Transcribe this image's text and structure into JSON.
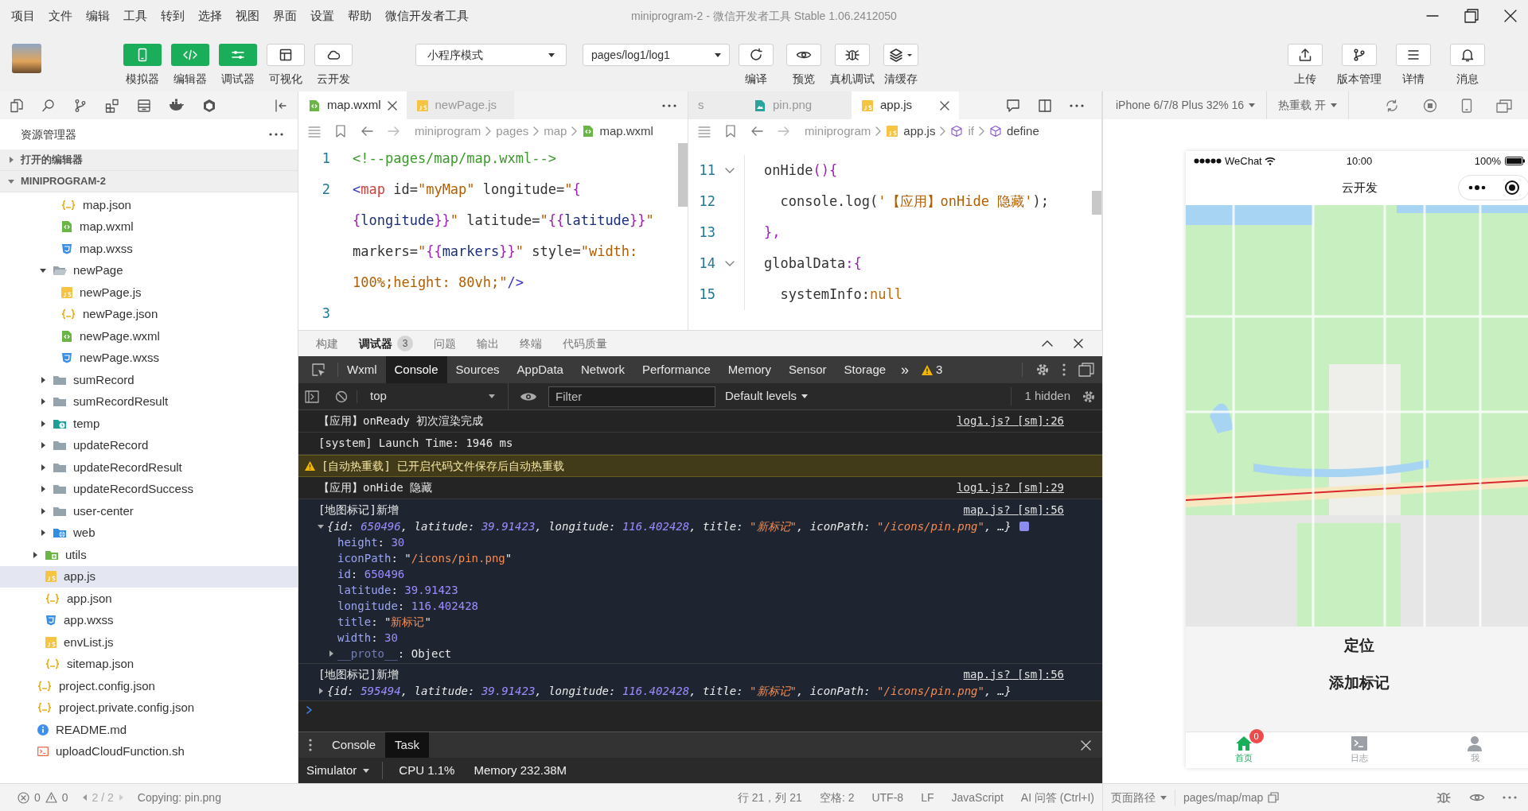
{
  "menu_bar": [
    "项目",
    "文件",
    "编辑",
    "工具",
    "转到",
    "选择",
    "视图",
    "界面",
    "设置",
    "帮助",
    "微信开发者工具"
  ],
  "window_title": "miniprogram-2 - 微信开发者工具 Stable 1.06.2412050",
  "toolbar": {
    "view_toggles": [
      {
        "label": "模拟器",
        "kind": "phone",
        "on": true
      },
      {
        "label": "编辑器",
        "kind": "code",
        "on": true
      },
      {
        "label": "调试器",
        "kind": "sliders",
        "on": true
      },
      {
        "label": "可视化",
        "kind": "layout",
        "on": false
      },
      {
        "label": "云开发",
        "kind": "cloud",
        "on": false
      }
    ],
    "mode_select": "小程序模式",
    "page_select": "pages/log1/log1",
    "actions": [
      {
        "label": "编译",
        "kind": "refresh"
      },
      {
        "label": "预览",
        "kind": "eye"
      },
      {
        "label": "真机调试",
        "kind": "bug"
      },
      {
        "label": "清缓存",
        "kind": "layers"
      }
    ],
    "right_actions": [
      {
        "label": "上传",
        "kind": "upload"
      },
      {
        "label": "版本管理",
        "kind": "branch"
      },
      {
        "label": "详情",
        "kind": "menu"
      },
      {
        "label": "消息",
        "kind": "bell"
      }
    ]
  },
  "explorer": {
    "title": "资源管理器",
    "sections": [
      {
        "label": "打开的编辑器",
        "expanded": false
      },
      {
        "label": "MINIPROGRAM-2",
        "expanded": true
      }
    ],
    "tree": [
      {
        "kind": "hidden",
        "children": [
          {
            "kind": "hidden",
            "children": [
              {
                "kind": "hidden",
                "children": [
                  {
                    "label": "map.json",
                    "kind": "json",
                    "selected": false
                  },
                  {
                    "label": "map.wxml",
                    "kind": "wxml",
                    "selected": false
                  },
                  {
                    "label": "map.wxss",
                    "kind": "wxss",
                    "selected": false
                  }
                ]
              },
              {
                "label": "newPage",
                "kind": "folder",
                "selected": false,
                "expanded": true,
                "children": [
                  {
                    "label": "newPage.js",
                    "kind": "js",
                    "selected": false
                  },
                  {
                    "label": "newPage.json",
                    "kind": "json",
                    "selected": false
                  },
                  {
                    "label": "newPage.wxml",
                    "kind": "wxml",
                    "selected": false
                  },
                  {
                    "label": "newPage.wxss",
                    "kind": "wxss",
                    "selected": false
                  }
                ]
              },
              {
                "label": "sumRecord",
                "kind": "folder",
                "selected": false,
                "expanded": false
              },
              {
                "label": "sumRecordResult",
                "kind": "folder",
                "selected": false,
                "expanded": false
              },
              {
                "label": "temp",
                "kind": "folder-temp",
                "selected": false,
                "expanded": false
              },
              {
                "label": "updateRecord",
                "kind": "folder",
                "selected": false,
                "expanded": false
              },
              {
                "label": "updateRecordResult",
                "kind": "folder",
                "selected": false,
                "expanded": false
              },
              {
                "label": "updateRecordSuccess",
                "kind": "folder",
                "selected": false,
                "expanded": false
              },
              {
                "label": "user-center",
                "kind": "folder",
                "selected": false,
                "expanded": false
              },
              {
                "label": "web",
                "kind": "folder-web",
                "selected": false,
                "expanded": false
              }
            ]
          },
          {
            "label": "utils",
            "kind": "folder-utils",
            "selected": false,
            "expanded": false
          },
          {
            "label": "app.js",
            "kind": "js",
            "selected": true
          },
          {
            "label": "app.json",
            "kind": "json",
            "selected": false
          },
          {
            "label": "app.wxss",
            "kind": "wxss",
            "selected": false
          },
          {
            "label": "envList.js",
            "kind": "js",
            "selected": false
          },
          {
            "label": "sitemap.json",
            "kind": "json",
            "selected": false
          }
        ]
      },
      {
        "label": "project.config.json",
        "kind": "json",
        "selected": false
      },
      {
        "label": "project.private.config.json",
        "kind": "json",
        "selected": false
      },
      {
        "label": "README.md",
        "kind": "info",
        "selected": false
      },
      {
        "label": "uploadCloudFunction.sh",
        "kind": "shell",
        "selected": false
      }
    ]
  },
  "editor_left": {
    "tabs": [
      {
        "label": "map.wxml",
        "kind": "wxml",
        "selected": true
      },
      {
        "label": "newPage.js",
        "kind": "js",
        "selected": false
      }
    ],
    "breadcrumb": [
      {
        "label": "miniprogram",
        "kind": "none"
      },
      {
        "label": "pages",
        "kind": "none"
      },
      {
        "label": "map",
        "kind": "none"
      },
      {
        "label": "map.wxml",
        "kind": "wxml"
      }
    ],
    "lines": [
      {
        "number": "1",
        "rows": [
          {
            "tokens": [
              {
                "text": "<!--pages/map/map.wxml-->",
                "kind": "comment"
              }
            ]
          }
        ]
      },
      {
        "number": "2",
        "rows": [
          {
            "tokens": [
              {
                "text": "<",
                "kind": "tagp"
              },
              {
                "text": "map",
                "kind": "tag"
              },
              {
                "text": " id=",
                "kind": "attr"
              },
              {
                "text": "\"myMap\"",
                "kind": "str"
              },
              {
                "text": " longitude=",
                "kind": "attr"
              },
              {
                "text": "\"",
                "kind": "str"
              },
              {
                "text": "{",
                "kind": "brace"
              }
            ]
          },
          {
            "tokens": [
              {
                "text": "{",
                "kind": "brace"
              },
              {
                "text": "longitude",
                "kind": "var"
              },
              {
                "text": "}}",
                "kind": "brace"
              },
              {
                "text": "\"",
                "kind": "str"
              },
              {
                "text": " latitude=",
                "kind": "attr"
              },
              {
                "text": "\"",
                "kind": "str"
              },
              {
                "text": "{{",
                "kind": "brace"
              },
              {
                "text": "latitude",
                "kind": "var"
              },
              {
                "text": "}}",
                "kind": "brace"
              },
              {
                "text": "\"",
                "kind": "str"
              }
            ]
          },
          {
            "tokens": [
              {
                "text": "markers=",
                "kind": "attr"
              },
              {
                "text": "\"",
                "kind": "str"
              },
              {
                "text": "{{",
                "kind": "brace"
              },
              {
                "text": "markers",
                "kind": "var"
              },
              {
                "text": "}}",
                "kind": "brace"
              },
              {
                "text": "\"",
                "kind": "str"
              },
              {
                "text": " style=",
                "kind": "attr"
              },
              {
                "text": "\"width:",
                "kind": "str"
              }
            ]
          },
          {
            "tokens": [
              {
                "text": "100%;height: 80vh;\"",
                "kind": "str"
              },
              {
                "text": "/>",
                "kind": "tagp"
              }
            ]
          }
        ]
      },
      {
        "number": "3",
        "rows": [
          {
            "tokens": []
          }
        ]
      }
    ]
  },
  "editor_right": {
    "tabs": [
      {
        "label": "s",
        "kind": "none",
        "selected": false
      },
      {
        "label": "pin.png",
        "kind": "png",
        "selected": false
      },
      {
        "label": "app.js",
        "kind": "js",
        "selected": true
      }
    ],
    "breadcrumb": [
      {
        "label": "miniprogram",
        "kind": "none"
      },
      {
        "label": "app.js",
        "kind": "js"
      },
      {
        "label": "if",
        "kind": "cube"
      },
      {
        "label": "define",
        "kind": "cube"
      }
    ],
    "lines": [
      {
        "number": "11",
        "foldable": true,
        "rows": [
          {
            "tokens": [
              {
                "text": "onHide",
                "kind": "fn"
              },
              {
                "text": "(){",
                "kind": "brace"
              }
            ]
          }
        ]
      },
      {
        "number": "12",
        "foldable": false,
        "rows": [
          {
            "tokens": [
              {
                "text": "  console.log(",
                "kind": "fn"
              },
              {
                "text": "'【应用】onHide 隐藏'",
                "kind": "str"
              },
              {
                "text": ");",
                "kind": "fn"
              }
            ]
          }
        ]
      },
      {
        "number": "13",
        "foldable": false,
        "rows": [
          {
            "tokens": [
              {
                "text": "},",
                "kind": "brace"
              }
            ]
          }
        ]
      },
      {
        "number": "14",
        "foldable": true,
        "rows": [
          {
            "tokens": [
              {
                "text": "globalData",
                "kind": "fn"
              },
              {
                "text": ":{",
                "kind": "brace"
              }
            ]
          }
        ]
      },
      {
        "number": "15",
        "foldable": false,
        "rows": [
          {
            "tokens": [
              {
                "text": "  systemInfo:",
                "kind": "fn"
              },
              {
                "text": "null",
                "kind": "kw"
              }
            ]
          }
        ]
      }
    ]
  },
  "panel_tabs": [
    {
      "label": "构建",
      "selected": false
    },
    {
      "label": "调试器",
      "selected": true,
      "badge": "3"
    },
    {
      "label": "问题",
      "selected": false
    },
    {
      "label": "输出",
      "selected": false
    },
    {
      "label": "终端",
      "selected": false
    },
    {
      "label": "代码质量",
      "selected": false
    }
  ],
  "devtools": {
    "tabs": [
      {
        "label": "Wxml",
        "selected": false
      },
      {
        "label": "Console",
        "selected": true
      },
      {
        "label": "Sources",
        "selected": false
      },
      {
        "label": "AppData",
        "selected": false
      },
      {
        "label": "Network",
        "selected": false
      },
      {
        "label": "Performance",
        "selected": false
      },
      {
        "label": "Memory",
        "selected": false
      },
      {
        "label": "Sensor",
        "selected": false
      },
      {
        "label": "Storage",
        "selected": false
      }
    ],
    "more": "»",
    "warnings": "3",
    "context": "top",
    "filter_placeholder": "Filter",
    "levels": "Default levels",
    "hidden_count": "1 hidden"
  },
  "console": [
    {
      "kind": "log",
      "text": "【应用】onReady 初次渲染完成",
      "source": "log1.js? [sm]:26"
    },
    {
      "kind": "log",
      "text": "[system] Launch Time: 1946 ms"
    },
    {
      "kind": "warning",
      "text": "[自动热重载] 已开启代码文件保存后自动热重载"
    },
    {
      "kind": "log",
      "text": "【应用】onHide 隐藏",
      "source": "log1.js? [sm]:29"
    },
    {
      "kind": "object",
      "text": "[地图标记]新增",
      "source": "map.js? [sm]:56",
      "expanded": true,
      "summary": [
        {
          "text": "{",
          "kind": "p"
        },
        {
          "text": "id",
          "kind": "k"
        },
        {
          "text": ": ",
          "kind": "p"
        },
        {
          "text": "650496",
          "kind": "n"
        },
        {
          "text": ", ",
          "kind": "p"
        },
        {
          "text": "latitude",
          "kind": "k"
        },
        {
          "text": ": ",
          "kind": "p"
        },
        {
          "text": "39.91423",
          "kind": "n"
        },
        {
          "text": ", ",
          "kind": "p"
        },
        {
          "text": "longitude",
          "kind": "k"
        },
        {
          "text": ": ",
          "kind": "p"
        },
        {
          "text": "116.402428",
          "kind": "n"
        },
        {
          "text": ", ",
          "kind": "p"
        },
        {
          "text": "title",
          "kind": "k"
        },
        {
          "text": ": ",
          "kind": "p"
        },
        {
          "text": "\"新标记\"",
          "kind": "s"
        },
        {
          "text": ", ",
          "kind": "p"
        },
        {
          "text": "iconPath",
          "kind": "k"
        },
        {
          "text": ": ",
          "kind": "p"
        },
        {
          "text": "\"/icons/pin.png\"",
          "kind": "s"
        },
        {
          "text": ", …}",
          "kind": "p"
        }
      ],
      "properties": [
        {
          "expandable": false,
          "tokens": [
            {
              "text": "height",
              "kind": "pk"
            },
            {
              "text": ": ",
              "kind": "p"
            },
            {
              "text": "30",
              "kind": "n"
            }
          ]
        },
        {
          "expandable": false,
          "tokens": [
            {
              "text": "iconPath",
              "kind": "pk"
            },
            {
              "text": ": \"",
              "kind": "p"
            },
            {
              "text": "/icons/pin.png",
              "kind": "s"
            },
            {
              "text": "\"",
              "kind": "p"
            }
          ]
        },
        {
          "expandable": false,
          "tokens": [
            {
              "text": "id",
              "kind": "pk"
            },
            {
              "text": ": ",
              "kind": "p"
            },
            {
              "text": "650496",
              "kind": "n"
            }
          ]
        },
        {
          "expandable": false,
          "tokens": [
            {
              "text": "latitude",
              "kind": "pk"
            },
            {
              "text": ": ",
              "kind": "p"
            },
            {
              "text": "39.91423",
              "kind": "n"
            }
          ]
        },
        {
          "expandable": false,
          "tokens": [
            {
              "text": "longitude",
              "kind": "pk"
            },
            {
              "text": ": ",
              "kind": "p"
            },
            {
              "text": "116.402428",
              "kind": "n"
            }
          ]
        },
        {
          "expandable": false,
          "tokens": [
            {
              "text": "title",
              "kind": "pk"
            },
            {
              "text": ": \"",
              "kind": "p"
            },
            {
              "text": "新标记",
              "kind": "s"
            },
            {
              "text": "\"",
              "kind": "p"
            }
          ]
        },
        {
          "expandable": false,
          "tokens": [
            {
              "text": "width",
              "kind": "pk"
            },
            {
              "text": ": ",
              "kind": "p"
            },
            {
              "text": "30",
              "kind": "n"
            }
          ]
        },
        {
          "expandable": true,
          "tokens": [
            {
              "text": "__proto__",
              "kind": "pf"
            },
            {
              "text": ": Object",
              "kind": "p"
            }
          ]
        }
      ]
    },
    {
      "kind": "object",
      "text": "[地图标记]新增",
      "source": "map.js? [sm]:56",
      "expanded": false,
      "summary": [
        {
          "text": "{",
          "kind": "p"
        },
        {
          "text": "id",
          "kind": "k"
        },
        {
          "text": ": ",
          "kind": "p"
        },
        {
          "text": "595494",
          "kind": "n"
        },
        {
          "text": ", ",
          "kind": "p"
        },
        {
          "text": "latitude",
          "kind": "k"
        },
        {
          "text": ": ",
          "kind": "p"
        },
        {
          "text": "39.91423",
          "kind": "n"
        },
        {
          "text": ", ",
          "kind": "p"
        },
        {
          "text": "longitude",
          "kind": "k"
        },
        {
          "text": ": ",
          "kind": "p"
        },
        {
          "text": "116.402428",
          "kind": "n"
        },
        {
          "text": ", ",
          "kind": "p"
        },
        {
          "text": "title",
          "kind": "k"
        },
        {
          "text": ": ",
          "kind": "p"
        },
        {
          "text": "\"新标记\"",
          "kind": "s"
        },
        {
          "text": ", ",
          "kind": "p"
        },
        {
          "text": "iconPath",
          "kind": "k"
        },
        {
          "text": ": ",
          "kind": "p"
        },
        {
          "text": "\"/icons/pin.png\"",
          "kind": "s"
        },
        {
          "text": ", …}",
          "kind": "p"
        }
      ]
    }
  ],
  "drawer": {
    "tabs": [
      {
        "label": "Console",
        "selected": false
      },
      {
        "label": "Task",
        "selected": true
      }
    ],
    "target": "Simulator",
    "cpu": "CPU 1.1%",
    "memory": "Memory 232.38M"
  },
  "status_bar": {
    "errors": "0",
    "warnings": "0",
    "pager": "2 / 2",
    "message": "Copying: pin.png",
    "position": "行 21，列 21",
    "indent": "空格: 2",
    "encoding": "UTF-8",
    "eol": "LF",
    "language": "JavaScript",
    "ai": "AI 问答 (Ctrl+I)",
    "page_path_label": "页面路径",
    "page_path": "pages/map/map"
  },
  "simulator": {
    "device": "iPhone 6/7/8 Plus 32% 16",
    "hot_reload": "热重载 开",
    "phone": {
      "carrier": "WeChat",
      "time": "10:00",
      "battery": "100%",
      "title": "云开发",
      "buttons": [
        "定位",
        "添加标记"
      ],
      "tabs": [
        {
          "label": "首页",
          "kind": "home",
          "selected": true,
          "badge": "0"
        },
        {
          "label": "日志",
          "kind": "terminal",
          "selected": false
        },
        {
          "label": "我",
          "kind": "person",
          "selected": false
        }
      ]
    }
  }
}
